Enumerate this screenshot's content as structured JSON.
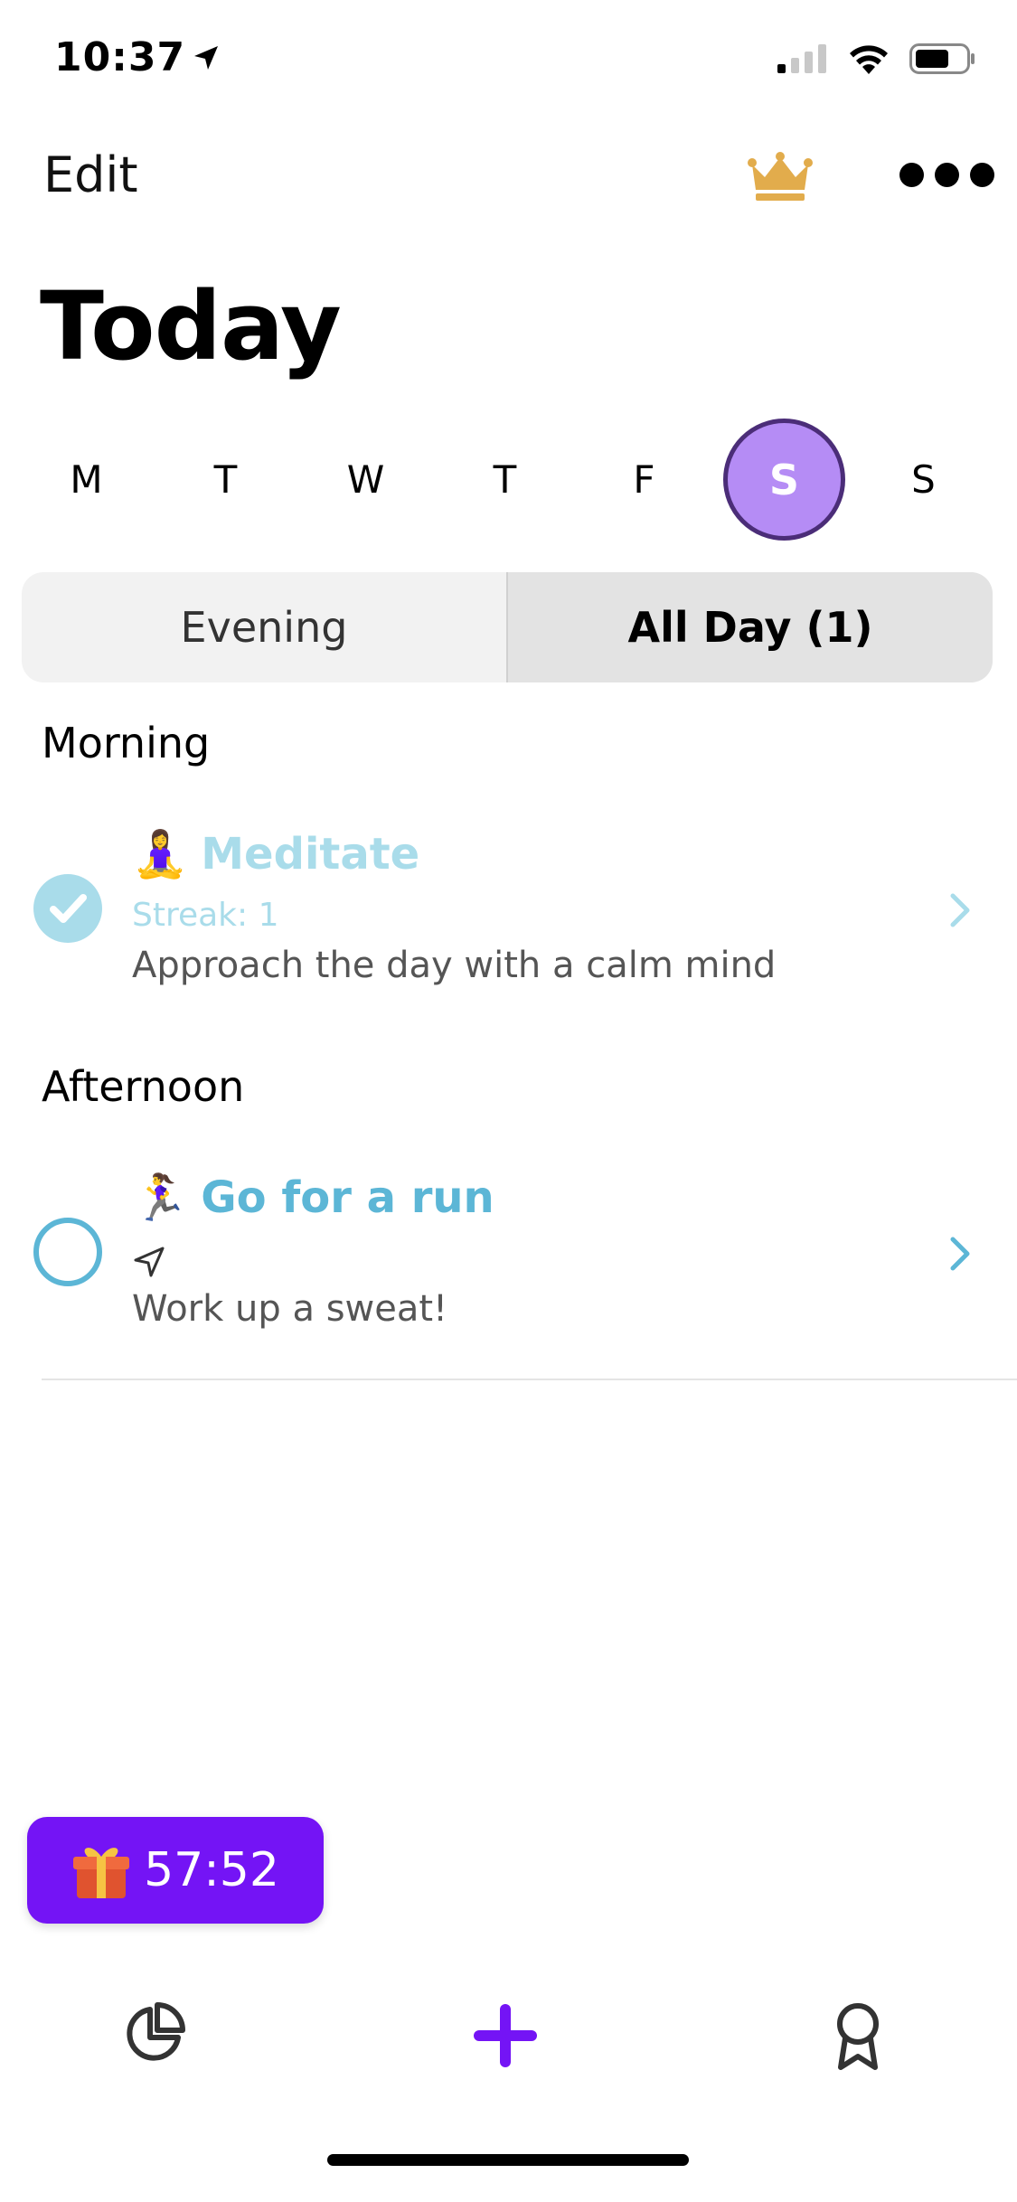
{
  "status_bar": {
    "time": "10:37"
  },
  "nav": {
    "edit_label": "Edit"
  },
  "title": "Today",
  "week": {
    "days": [
      "M",
      "T",
      "W",
      "T",
      "F",
      "S",
      "S"
    ],
    "active_index": 5
  },
  "segmented": {
    "options": [
      "Evening",
      "All Day (1)"
    ],
    "selected_index": 1
  },
  "sections": {
    "morning": "Morning",
    "afternoon": "Afternoon"
  },
  "habits": [
    {
      "emoji": "🧘‍♀️",
      "title": "Meditate",
      "streak": "Streak: 1",
      "description": "Approach the day with a calm mind",
      "completed": true,
      "color": "#a9dcea"
    },
    {
      "emoji": "🏃‍♀️",
      "title": "Go for a run",
      "description": "Work up a sweat!",
      "completed": false,
      "color": "#5cb6d6"
    }
  ],
  "promo": {
    "timer": "57:52"
  },
  "colors": {
    "accent_purple": "#7414f5",
    "active_day": "#b58cf5",
    "crown": "#e2ac4c"
  }
}
